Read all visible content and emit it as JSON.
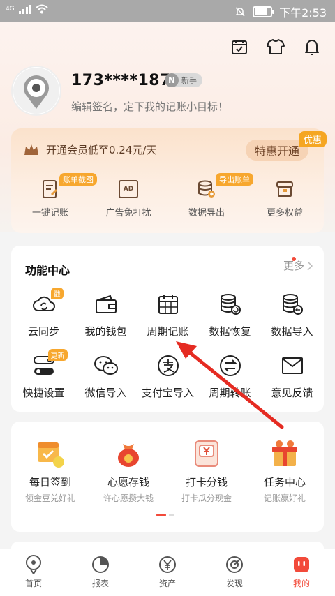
{
  "status_bar": {
    "network": "4G",
    "time": "下午2:53"
  },
  "profile": {
    "username": "173****1871",
    "level_badge_letter": "N",
    "level_badge_text": "新手",
    "signature": "编辑签名，定下我的记账小目标！"
  },
  "member": {
    "promo_text": "开通会员低至0.24元/天",
    "open_button": "特惠开通",
    "ribbon": "优惠",
    "items": [
      {
        "label": "一键记账",
        "tag": "账单截图",
        "icon": "quick-bill-icon"
      },
      {
        "label": "广告免打扰",
        "tag": "",
        "icon": "ad-icon",
        "icon_text": "AD"
      },
      {
        "label": "数据导出",
        "tag": "导出账单",
        "icon": "data-export-icon"
      },
      {
        "label": "更多权益",
        "tag": "",
        "icon": "more-rights-icon"
      }
    ]
  },
  "function_center": {
    "title": "功能中心",
    "more": "更多",
    "items": [
      {
        "label": "云同步",
        "tag": "戳",
        "icon": "cloud-sync-icon"
      },
      {
        "label": "我的钱包",
        "tag": "",
        "icon": "wallet-icon"
      },
      {
        "label": "周期记账",
        "tag": "",
        "icon": "calendar-icon"
      },
      {
        "label": "数据恢复",
        "tag": "",
        "icon": "data-restore-icon"
      },
      {
        "label": "数据导入",
        "tag": "",
        "icon": "data-import-icon"
      },
      {
        "label": "快捷设置",
        "tag": "更新",
        "icon": "toggle-icon"
      },
      {
        "label": "微信导入",
        "tag": "",
        "icon": "wechat-icon"
      },
      {
        "label": "支付宝导入",
        "tag": "",
        "icon": "alipay-icon"
      },
      {
        "label": "周期转账",
        "tag": "",
        "icon": "transfer-icon"
      },
      {
        "label": "意见反馈",
        "tag": "",
        "icon": "mail-icon"
      }
    ]
  },
  "tasks": {
    "items": [
      {
        "title": "每日签到",
        "subtitle": "领金豆兑好礼",
        "icon": "checkin-calendar-icon"
      },
      {
        "title": "心愿存钱",
        "subtitle": "许心愿攒大钱",
        "icon": "money-bag-icon"
      },
      {
        "title": "打卡分钱",
        "subtitle": "打卡瓜分现金",
        "icon": "punch-card-icon"
      },
      {
        "title": "任务中心",
        "subtitle": "记账赢好礼",
        "icon": "gift-box-icon"
      }
    ]
  },
  "bottom_nav": [
    {
      "label": "首页",
      "icon": "home-icon",
      "active": false
    },
    {
      "label": "报表",
      "icon": "report-icon",
      "active": false
    },
    {
      "label": "资产",
      "icon": "assets-icon",
      "active": false
    },
    {
      "label": "发现",
      "icon": "discover-icon",
      "active": false
    },
    {
      "label": "我的",
      "icon": "mine-icon",
      "active": true
    }
  ],
  "colors": {
    "accent": "#f24a3a",
    "tag_orange": "#f7a72e",
    "member_text": "#5b3a24"
  }
}
